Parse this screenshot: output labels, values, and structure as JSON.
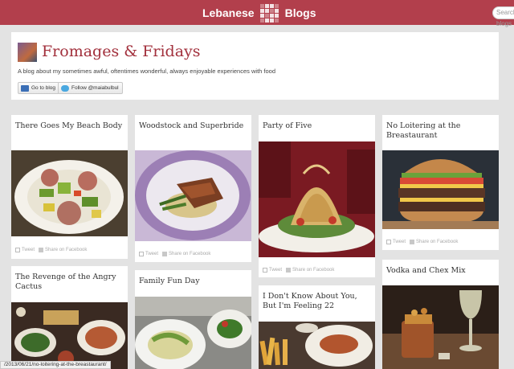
{
  "topbar": {
    "brand_left": "Lebanese",
    "brand_right": "Blogs",
    "search_placeholder": "Search blogs",
    "bg_color": "#b23f4c"
  },
  "blog": {
    "title": "Fromages & Fridays",
    "description": "A blog about my sometimes awful, oftentimes wonderful, always enjoyable experiences with food",
    "buttons": {
      "go_to_blog": "Go to blog",
      "follow": "Follow @maiabulbul"
    },
    "title_color": "#a2303c"
  },
  "cards": [
    {
      "title": "There Goes My Beach Body",
      "photo": "plate-of-greens-and-sausage",
      "tweet": "Tweet",
      "share": "Share on Facebook"
    },
    {
      "title": "Woodstock and Superbride",
      "photo": "fish-fillet-on-purple-plate",
      "tweet": "Tweet",
      "share": "Share on Facebook"
    },
    {
      "title": "Party of Five",
      "photo": "tall-fried-noodle-salad",
      "tweet": "Tweet",
      "share": "Share on Facebook"
    },
    {
      "title": "No Loitering at the Breastaurant",
      "photo": "double-cheeseburger",
      "tweet": "Tweet",
      "share": "Share on Facebook"
    },
    {
      "title": "The Revenge of the Angry Cactus",
      "photo": "tex-mex-table-spread"
    },
    {
      "title": "Family Fun Day",
      "photo": "salad-plates-at-table"
    },
    {
      "title": "I Don't Know About You, But I'm Feeling 22",
      "photo": "fries-and-dishes"
    },
    {
      "title": "Vodka and Chex Mix",
      "photo": "wine-glass-and-snacks"
    }
  ],
  "status_url": "/2013/06/21/no-loitering-at-the-breastaurant/"
}
